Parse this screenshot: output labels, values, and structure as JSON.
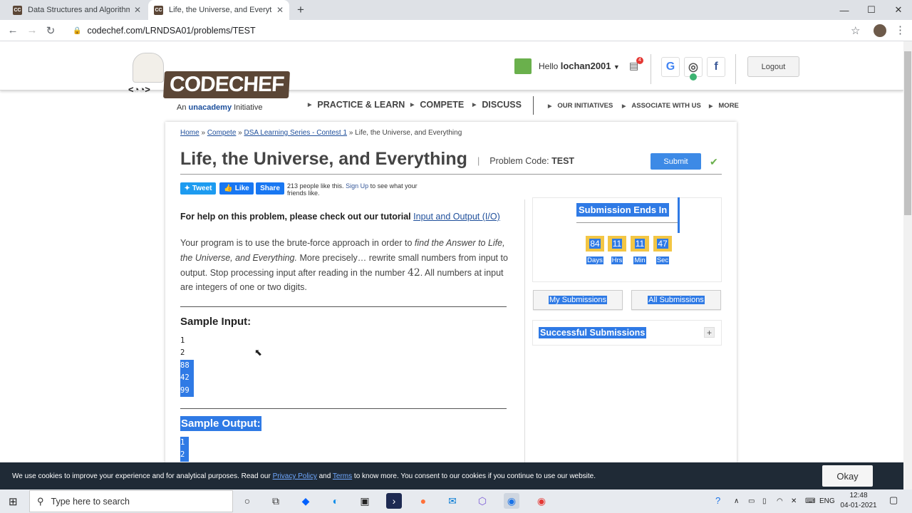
{
  "browser": {
    "tabs": [
      {
        "title": "Data Structures and Algorithms C",
        "favicon": "CC"
      },
      {
        "title": "Life, the Universe, and Everything",
        "favicon": "CC"
      }
    ],
    "new_tab": "+",
    "url": "codechef.com/LRNDSA01/problems/TEST"
  },
  "site": {
    "logo": {
      "word": "CODECHEF",
      "tag_prefix": "An",
      "tag_brand": "unacademy",
      "tag_suffix": "Initiative"
    },
    "nav": [
      "PRACTICE & LEARN",
      "COMPETE",
      "DISCUSS"
    ],
    "subnav": [
      "OUR INITIATIVES",
      "ASSOCIATE WITH US",
      "MORE"
    ],
    "user": {
      "hello": "Hello",
      "name": "lochan2001"
    },
    "notifications": "4",
    "logout": "Logout"
  },
  "problem": {
    "breadcrumb": {
      "home": "Home",
      "compete": "Compete",
      "contest": "DSA Learning Series - Contest 1",
      "current": "» Life, the Universe, and Everything"
    },
    "title": "Life, the Universe, and Everything",
    "code_label": "Problem Code:",
    "code": "TEST",
    "submit": "Submit",
    "share": {
      "tweet": "Tweet",
      "like": "Like",
      "share": "Share",
      "fb_count": "213 people like this.",
      "fb_signup": "Sign Up",
      "fb_rest": "to see what your friends like."
    },
    "help_text": "For help on this problem, please check out our tutorial",
    "help_link": "Input and Output (I/O)",
    "desc_1": "Your program is to use the brute-force approach in order to",
    "desc_italic": "find the Answer to Life, the Universe, and Everything.",
    "desc_2": "More precisely… rewrite small numbers from input to output. Stop processing input after reading in the number",
    "desc_num": "42",
    "desc_3": ". All numbers at input are integers of one or two digits.",
    "sample_input_title": "Sample Input:",
    "sample_input": [
      "1",
      "2",
      "88",
      "42",
      "99"
    ],
    "sample_output_title": "Sample Output:",
    "sample_output": [
      "1",
      "2"
    ]
  },
  "sidebar": {
    "timer_title": "Submission Ends In",
    "timer": [
      {
        "value": "84",
        "label": "Days"
      },
      {
        "value": "11",
        "label": "Hrs"
      },
      {
        "value": "11",
        "label": "Min"
      },
      {
        "value": "47",
        "label": "Sec"
      }
    ],
    "my_submissions": "My Submissions",
    "all_submissions": "All Submissions",
    "successful": "Successful Submissions"
  },
  "cookie": {
    "t1": "We use cookies to improve your experience and for analytical purposes. Read our",
    "privacy": "Privacy Policy",
    "and": "and",
    "terms": "Terms",
    "t2": "to know more. You consent to our cookies if you continue to use our website.",
    "okay": "Okay"
  },
  "taskbar": {
    "search": "Type here to search",
    "lang": "ENG",
    "time": "12:48",
    "date": "04-01-2021"
  }
}
